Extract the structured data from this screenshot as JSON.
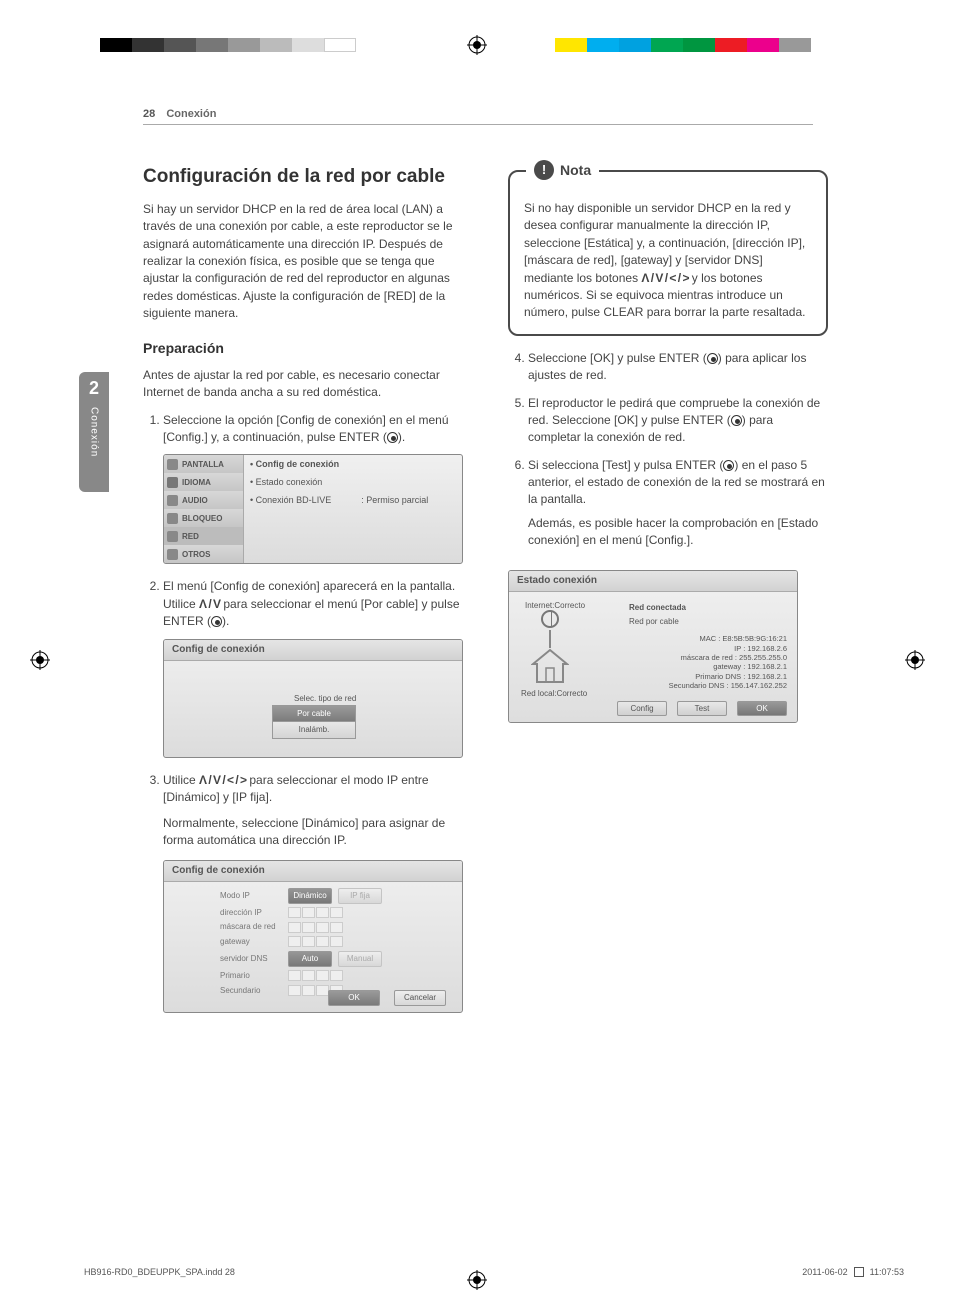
{
  "header": {
    "page_number": "28",
    "section": "Conexión"
  },
  "side_tab": {
    "chapter_number": "2",
    "chapter_label": "Conexión"
  },
  "left": {
    "h1": "Configuración de la red por cable",
    "p1": "Si hay un servidor DHCP en la red de área local (LAN) a través de una conexión por cable, a este reproductor se le asignará automáticamente una dirección IP. Después de realizar la conexión física, es posible que se tenga que ajustar la configuración de red del reproductor en algunas redes domésticas. Ajuste la configuración de [RED] de la siguiente manera.",
    "h2": "Preparación",
    "p2": "Antes de ajustar la red por cable, es necesario conectar Internet de banda ancha a su red doméstica.",
    "li1a": "Seleccione la opción [Config de conexión] en el menú [Config.] y, a continuación, pulse ENTER (",
    "li1b": ").",
    "li2a": "El menú [Config de conexión] aparecerá en la pantalla. Utilice ",
    "arrows_ud": "Ʌ / V",
    "li2b": " para seleccionar el menú [Por cable] y pulse ENTER (",
    "li2c": ").",
    "li3a": "Utilice ",
    "arrows_all": "Ʌ / V / < / >",
    "li3b": " para seleccionar el modo IP entre [Dinámico] y [IP fija].",
    "p3": "Normalmente, seleccione [Dinámico] para asignar de forma automática una dirección IP."
  },
  "shot1": {
    "tabs": [
      "PANTALLA",
      "IDIOMA",
      "AUDIO",
      "BLOQUEO",
      "RED",
      "OTROS"
    ],
    "items": [
      "Config de conexión",
      "Estado conexión",
      "Conexión BD-LIVE"
    ],
    "value": ": Permiso parcial"
  },
  "shot2": {
    "title": "Config de conexión",
    "label": "Selec. tipo de red",
    "opt1": "Por cable",
    "opt2": "Inalámb."
  },
  "shot3": {
    "title": "Config de conexión",
    "modo_ip": "Modo IP",
    "din": "Dinámico",
    "ipfija": "IP fija",
    "dir": "dirección IP",
    "masc": "máscara de red",
    "gw": "gateway",
    "dns": "servidor DNS",
    "auto": "Auto",
    "manual": "Manual",
    "pri": "Primario",
    "sec": "Secundario",
    "ok": "OK",
    "cancel": "Cancelar"
  },
  "right": {
    "note_label": "Nota",
    "note_a": "Si no hay disponible un servidor DHCP en la red y desea configurar manualmente la dirección IP, seleccione [Estática] y, a continuación, [dirección IP], [máscara de red], [gateway] y [servidor DNS] mediante los botones ",
    "note_arrows": "Ʌ / V / < / >",
    "note_b": " y los botones numéricos. Si se equivoca mientras introduce un número, pulse CLEAR para borrar la parte resaltada.",
    "li4a": "Seleccione [OK] y pulse ENTER (",
    "li4b": ") para aplicar los ajustes de red.",
    "li5a": "El reproductor le pedirá que compruebe la conexión de red. Seleccione [OK] y pulse ENTER (",
    "li5b": ") para completar la conexión de red.",
    "li6a": "Si selecciona [Test] y pulsa ENTER (",
    "li6b": ") en el paso 5 anterior, el estado de conexión de la red se mostrará en la pantalla.",
    "li6c": "Además, es posible hacer la comprobación en [Estado conexión] en el menú [Config.]."
  },
  "shot4": {
    "title": "Estado conexión",
    "internet": "Internet:Correcto",
    "local": "Red local:Correcto",
    "r1": "Red conectada",
    "r2": "Red por cable",
    "kv": [
      "MAC : E8:5B:5B:9G:16:21",
      "IP : 192.168.2.6",
      "máscara de red : 255.255.255.0",
      "gateway : 192.168.2.1",
      "Primario DNS : 192.168.2.1",
      "Secundario DNS : 156.147.162.252"
    ],
    "config": "Config",
    "test": "Test",
    "ok": "OK"
  },
  "footer": {
    "file": "HB916-RD0_BDEUPPK_SPA.indd   28",
    "date": "2011-06-02",
    "time": "11:07:53"
  },
  "swatches_left": [
    "#000",
    "#333",
    "#555",
    "#777",
    "#999",
    "#bbb",
    "#ddd",
    "#fff"
  ],
  "swatches_right": [
    "#ffe600",
    "#e6007e",
    "#00a1e0",
    "#00a651",
    "#009640",
    "#ed1c24",
    "#ec008c",
    "#999"
  ]
}
